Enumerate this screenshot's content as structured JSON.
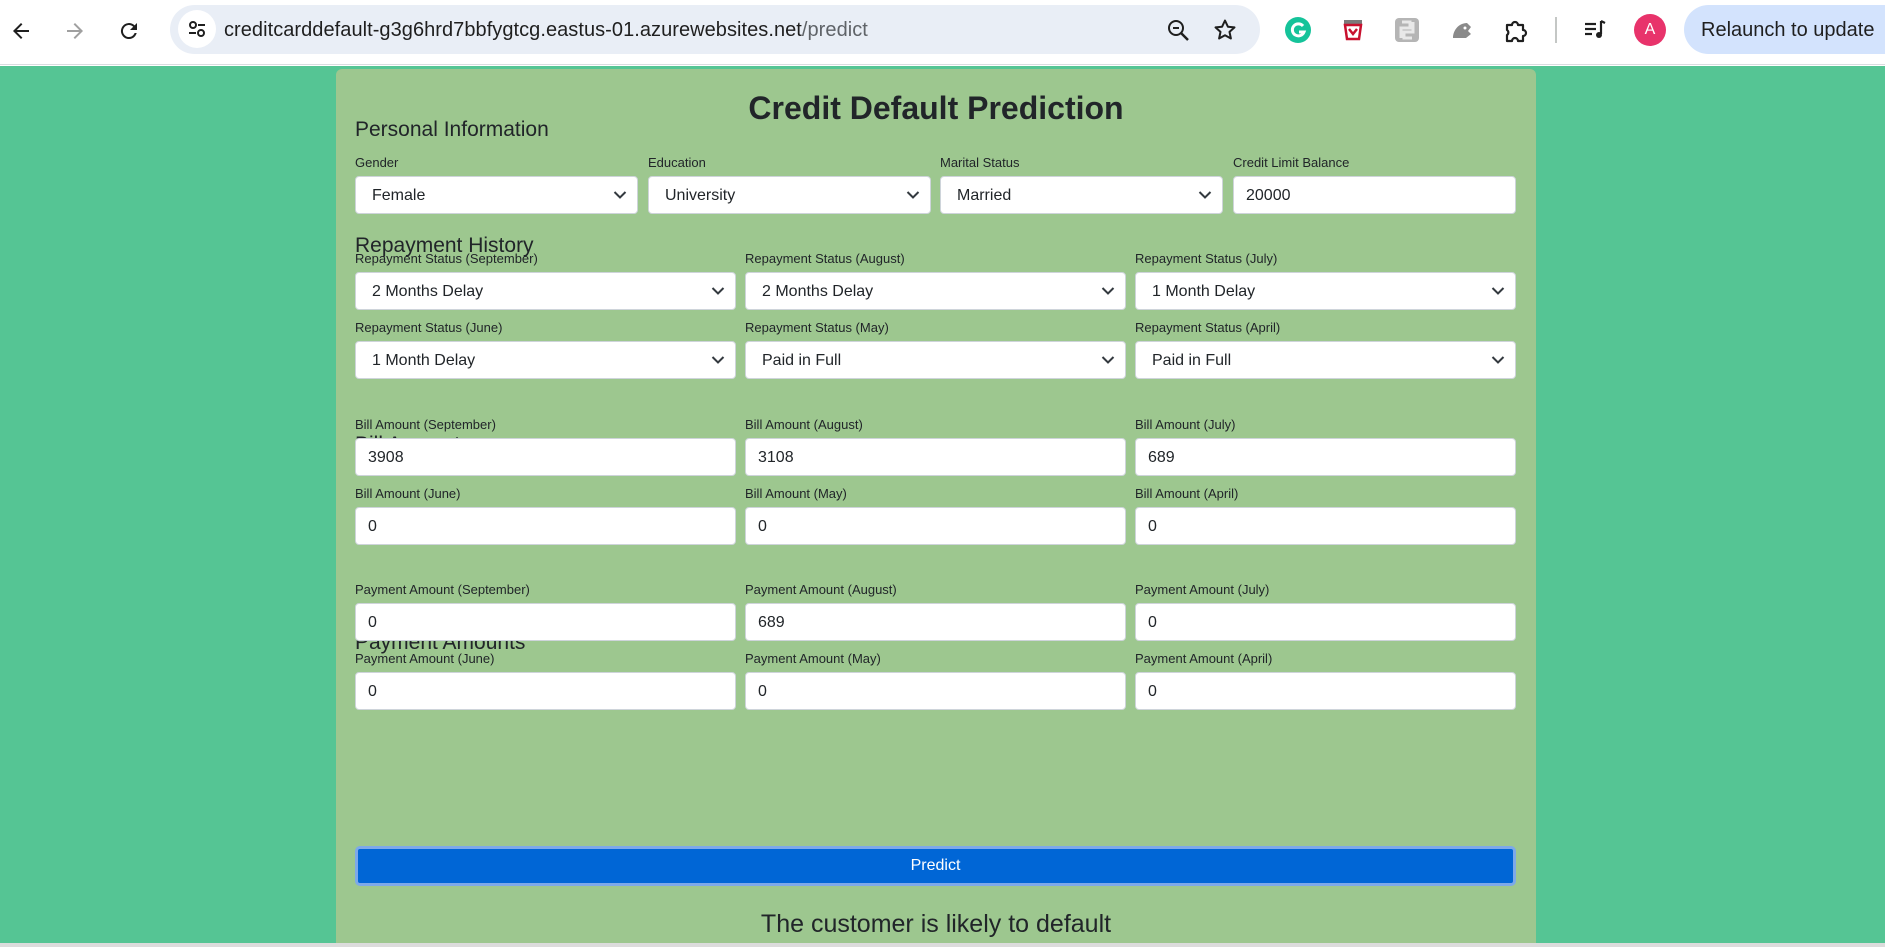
{
  "browser": {
    "url_host": "creditcarddefault-g3g6hrd7bbfygtcg.eastus-01.azurewebsites.net",
    "url_path": "/predict",
    "avatar_letter": "A",
    "relaunch_label": "Relaunch to update",
    "icons": [
      "back-icon",
      "forward-icon",
      "reload-icon",
      "site-info-icon",
      "zoom-icon",
      "bookmark-star-icon",
      "grammarly-icon",
      "extension-red-icon",
      "extension-python-icon",
      "extension-gray-icon",
      "extensions-puzzle-icon",
      "media-queue-icon"
    ]
  },
  "form": {
    "title": "Credit Default Prediction",
    "personal": {
      "heading": "Personal Information",
      "gender_label": "Gender",
      "gender_value": "Female",
      "education_label": "Education",
      "education_value": "University",
      "marital_label": "Marital Status",
      "marital_value": "Married",
      "limit_label": "Credit Limit Balance",
      "limit_value": "20000"
    },
    "repayment": {
      "heading": "Repayment History",
      "fields": [
        {
          "label": "Repayment Status (September)",
          "value": "2 Months Delay"
        },
        {
          "label": "Repayment Status (August)",
          "value": "2 Months Delay"
        },
        {
          "label": "Repayment Status (July)",
          "value": "1 Month Delay"
        },
        {
          "label": "Repayment Status (June)",
          "value": "1 Month Delay"
        },
        {
          "label": "Repayment Status (May)",
          "value": "Paid in Full"
        },
        {
          "label": "Repayment Status (April)",
          "value": "Paid in Full"
        }
      ]
    },
    "bill": {
      "heading": "Bill Amounts",
      "fields": [
        {
          "label": "Bill Amount (September)",
          "value": "3908"
        },
        {
          "label": "Bill Amount (August)",
          "value": "3108"
        },
        {
          "label": "Bill Amount (July)",
          "value": "689"
        },
        {
          "label": "Bill Amount (June)",
          "value": "0"
        },
        {
          "label": "Bill Amount (May)",
          "value": "0"
        },
        {
          "label": "Bill Amount (April)",
          "value": "0"
        }
      ]
    },
    "payment": {
      "heading": "Payment Amounts",
      "fields": [
        {
          "label": "Payment Amount (September)",
          "value": "0"
        },
        {
          "label": "Payment Amount (August)",
          "value": "689"
        },
        {
          "label": "Payment Amount (July)",
          "value": "0"
        },
        {
          "label": "Payment Amount (June)",
          "value": "0"
        },
        {
          "label": "Payment Amount (May)",
          "value": "0"
        },
        {
          "label": "Payment Amount (April)",
          "value": "0"
        }
      ]
    },
    "predict_label": "Predict",
    "result_text": "The customer is likely to default"
  },
  "colors": {
    "page_background": "#55c594",
    "card_background": "#9dc78f",
    "predict_button": "#0066d6",
    "avatar": "#e8336b",
    "relaunch_chip": "#d3e3fd"
  }
}
